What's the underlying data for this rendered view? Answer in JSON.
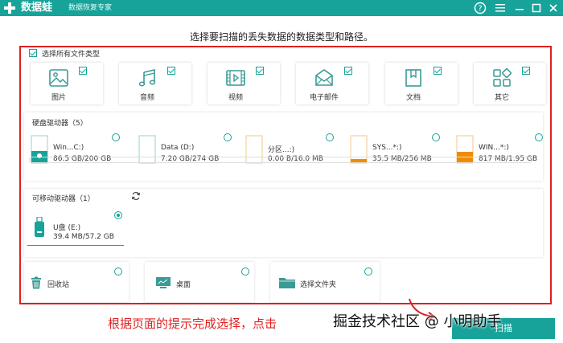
{
  "app": {
    "brand": "数据蛙",
    "tagline": "数据恢复专家",
    "brand_color": "#17a39a"
  },
  "titlebar_icons": [
    "help-icon",
    "menu-icon",
    "minimize-icon",
    "maximize-icon",
    "close-icon"
  ],
  "prompt": "选择要扫描的丢失数据的数据类型和路径。",
  "file_types": {
    "select_all_label": "选择所有文件类型",
    "items": [
      {
        "label": "图片",
        "icon": "image-icon",
        "checked": true
      },
      {
        "label": "音频",
        "icon": "audio-icon",
        "checked": true
      },
      {
        "label": "视频",
        "icon": "video-icon",
        "checked": true
      },
      {
        "label": "电子邮件",
        "icon": "email-icon",
        "checked": true
      },
      {
        "label": "文档",
        "icon": "document-icon",
        "checked": true
      },
      {
        "label": "其它",
        "icon": "other-icon",
        "checked": true
      }
    ]
  },
  "hard_drives": {
    "title": "硬盘驱动器（5）",
    "items": [
      {
        "name": "Win...C:)",
        "size": "86.5 GB/200 GB",
        "fill": 0.43,
        "fill_color": "#17a39a"
      },
      {
        "name": "Data (D:)",
        "size": "7.20 GB/274 GB",
        "fill": 0.03,
        "fill_color": "#17a39a"
      },
      {
        "name": "分区...:)",
        "size": "0.00  B/16.0 MB",
        "fill": 0.0,
        "fill_color": "#17a39a"
      },
      {
        "name": "SYS...*:)",
        "size": "35.5 MB/256 MB",
        "fill": 0.14,
        "fill_color": "#f08c00"
      },
      {
        "name": "WIN...*:)",
        "size": "817 MB/1.95 GB",
        "fill": 0.42,
        "fill_color": "#f08c00"
      }
    ]
  },
  "removable": {
    "title": "可移动驱动器（1）",
    "items": [
      {
        "name": "U盘 (E:)",
        "size": "39.4 MB/57.2 GB",
        "selected": true
      }
    ]
  },
  "locations": [
    {
      "label": "回收站",
      "icon": "recycle-bin-icon"
    },
    {
      "label": "桌面",
      "icon": "desktop-icon"
    },
    {
      "label": "选择文件夹",
      "icon": "folder-icon"
    }
  ],
  "annotation": "根据页面的提示完成选择，点击",
  "scan_button_label": "扫描",
  "watermark": "掘金技术社区 @ 小明助手"
}
